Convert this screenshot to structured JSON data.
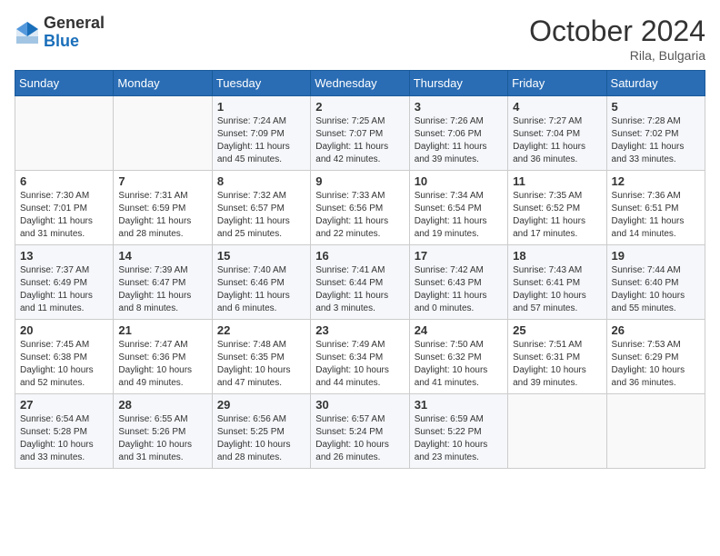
{
  "header": {
    "logo_general": "General",
    "logo_blue": "Blue",
    "month_title": "October 2024",
    "location": "Rila, Bulgaria"
  },
  "weekdays": [
    "Sunday",
    "Monday",
    "Tuesday",
    "Wednesday",
    "Thursday",
    "Friday",
    "Saturday"
  ],
  "weeks": [
    [
      {
        "day": "",
        "info": ""
      },
      {
        "day": "",
        "info": ""
      },
      {
        "day": "1",
        "info": "Sunrise: 7:24 AM\nSunset: 7:09 PM\nDaylight: 11 hours and 45 minutes."
      },
      {
        "day": "2",
        "info": "Sunrise: 7:25 AM\nSunset: 7:07 PM\nDaylight: 11 hours and 42 minutes."
      },
      {
        "day": "3",
        "info": "Sunrise: 7:26 AM\nSunset: 7:06 PM\nDaylight: 11 hours and 39 minutes."
      },
      {
        "day": "4",
        "info": "Sunrise: 7:27 AM\nSunset: 7:04 PM\nDaylight: 11 hours and 36 minutes."
      },
      {
        "day": "5",
        "info": "Sunrise: 7:28 AM\nSunset: 7:02 PM\nDaylight: 11 hours and 33 minutes."
      }
    ],
    [
      {
        "day": "6",
        "info": "Sunrise: 7:30 AM\nSunset: 7:01 PM\nDaylight: 11 hours and 31 minutes."
      },
      {
        "day": "7",
        "info": "Sunrise: 7:31 AM\nSunset: 6:59 PM\nDaylight: 11 hours and 28 minutes."
      },
      {
        "day": "8",
        "info": "Sunrise: 7:32 AM\nSunset: 6:57 PM\nDaylight: 11 hours and 25 minutes."
      },
      {
        "day": "9",
        "info": "Sunrise: 7:33 AM\nSunset: 6:56 PM\nDaylight: 11 hours and 22 minutes."
      },
      {
        "day": "10",
        "info": "Sunrise: 7:34 AM\nSunset: 6:54 PM\nDaylight: 11 hours and 19 minutes."
      },
      {
        "day": "11",
        "info": "Sunrise: 7:35 AM\nSunset: 6:52 PM\nDaylight: 11 hours and 17 minutes."
      },
      {
        "day": "12",
        "info": "Sunrise: 7:36 AM\nSunset: 6:51 PM\nDaylight: 11 hours and 14 minutes."
      }
    ],
    [
      {
        "day": "13",
        "info": "Sunrise: 7:37 AM\nSunset: 6:49 PM\nDaylight: 11 hours and 11 minutes."
      },
      {
        "day": "14",
        "info": "Sunrise: 7:39 AM\nSunset: 6:47 PM\nDaylight: 11 hours and 8 minutes."
      },
      {
        "day": "15",
        "info": "Sunrise: 7:40 AM\nSunset: 6:46 PM\nDaylight: 11 hours and 6 minutes."
      },
      {
        "day": "16",
        "info": "Sunrise: 7:41 AM\nSunset: 6:44 PM\nDaylight: 11 hours and 3 minutes."
      },
      {
        "day": "17",
        "info": "Sunrise: 7:42 AM\nSunset: 6:43 PM\nDaylight: 11 hours and 0 minutes."
      },
      {
        "day": "18",
        "info": "Sunrise: 7:43 AM\nSunset: 6:41 PM\nDaylight: 10 hours and 57 minutes."
      },
      {
        "day": "19",
        "info": "Sunrise: 7:44 AM\nSunset: 6:40 PM\nDaylight: 10 hours and 55 minutes."
      }
    ],
    [
      {
        "day": "20",
        "info": "Sunrise: 7:45 AM\nSunset: 6:38 PM\nDaylight: 10 hours and 52 minutes."
      },
      {
        "day": "21",
        "info": "Sunrise: 7:47 AM\nSunset: 6:36 PM\nDaylight: 10 hours and 49 minutes."
      },
      {
        "day": "22",
        "info": "Sunrise: 7:48 AM\nSunset: 6:35 PM\nDaylight: 10 hours and 47 minutes."
      },
      {
        "day": "23",
        "info": "Sunrise: 7:49 AM\nSunset: 6:34 PM\nDaylight: 10 hours and 44 minutes."
      },
      {
        "day": "24",
        "info": "Sunrise: 7:50 AM\nSunset: 6:32 PM\nDaylight: 10 hours and 41 minutes."
      },
      {
        "day": "25",
        "info": "Sunrise: 7:51 AM\nSunset: 6:31 PM\nDaylight: 10 hours and 39 minutes."
      },
      {
        "day": "26",
        "info": "Sunrise: 7:53 AM\nSunset: 6:29 PM\nDaylight: 10 hours and 36 minutes."
      }
    ],
    [
      {
        "day": "27",
        "info": "Sunrise: 6:54 AM\nSunset: 5:28 PM\nDaylight: 10 hours and 33 minutes."
      },
      {
        "day": "28",
        "info": "Sunrise: 6:55 AM\nSunset: 5:26 PM\nDaylight: 10 hours and 31 minutes."
      },
      {
        "day": "29",
        "info": "Sunrise: 6:56 AM\nSunset: 5:25 PM\nDaylight: 10 hours and 28 minutes."
      },
      {
        "day": "30",
        "info": "Sunrise: 6:57 AM\nSunset: 5:24 PM\nDaylight: 10 hours and 26 minutes."
      },
      {
        "day": "31",
        "info": "Sunrise: 6:59 AM\nSunset: 5:22 PM\nDaylight: 10 hours and 23 minutes."
      },
      {
        "day": "",
        "info": ""
      },
      {
        "day": "",
        "info": ""
      }
    ]
  ]
}
